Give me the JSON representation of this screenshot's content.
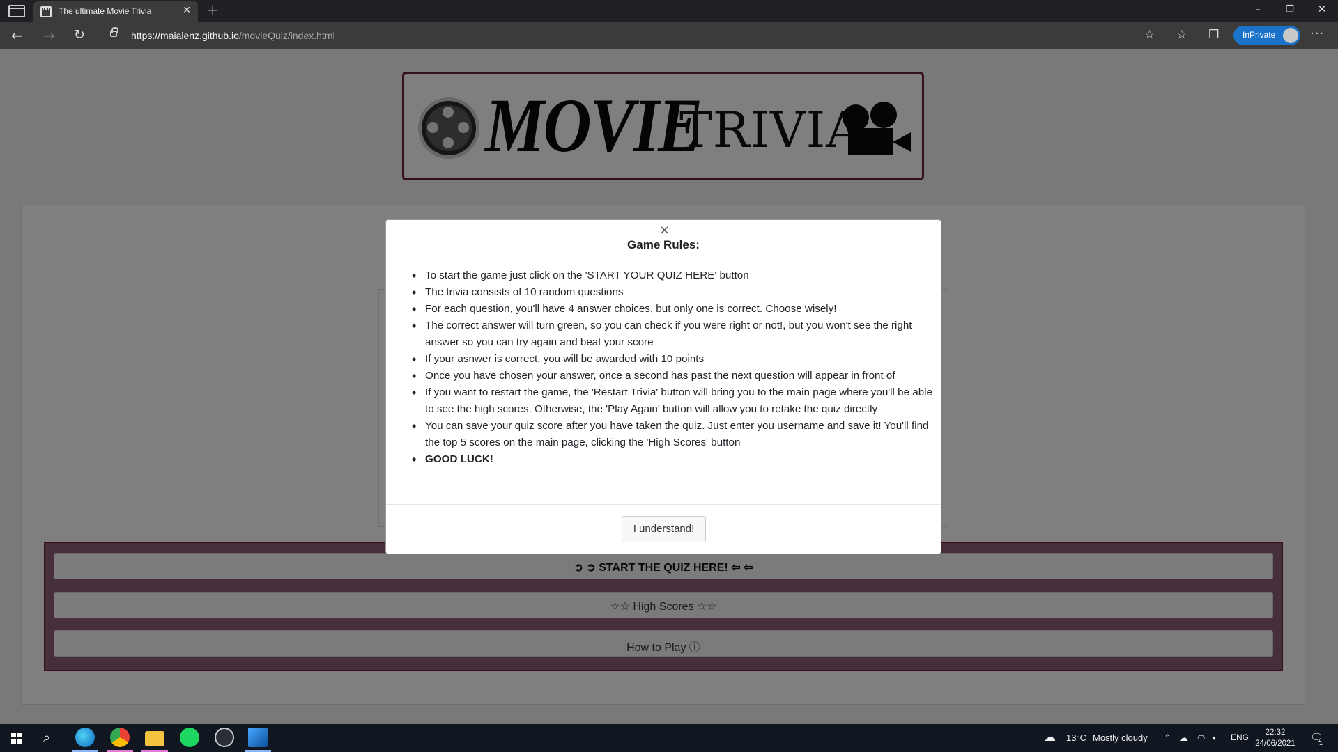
{
  "browser": {
    "tab_title": "The ultimate Movie Trivia",
    "url_host": "https://maialenz.github.io",
    "url_path": "/movieQuiz/index.html",
    "inprivate_label": "InPrivate"
  },
  "logo": {
    "word1": "MOVIE",
    "word2": "TRIVIA"
  },
  "modal": {
    "close_glyph": "×",
    "title": "Game Rules:",
    "rules": [
      "To start the game just click on the 'START YOUR QUIZ HERE' button",
      "The trivia consists of 10 random questions",
      "For each question, you'll have 4 answer choices, but only one is correct. Choose wisely!",
      "The correct answer will turn green, so you can check if you were right or not!, but you won't see the right answer so you can try again and beat your score",
      "If your asnwer is correct, you will be awarded with 10 points",
      "Once you have chosen your answer, once a second has past the next question will appear in front of",
      "If you want to restart the game, the 'Restart Trivia' button will bring you to the main page where you'll be able to see the high scores. Otherwise, the 'Play Again' button will allow you to retake the quiz directly",
      "You can save your quiz score after you have taken the quiz. Just enter you username and save it! You'll find the top 5 scores on the main page, clicking the 'High Scores' button",
      "GOOD LUCK!"
    ],
    "confirm_label": "I understand!"
  },
  "buttons": {
    "start": "➔ ➔ START THE QUIZ HERE! ← ←",
    "start_text": "START THE QUIZ HERE!",
    "high_scores": "High Scores",
    "how_to_play": "How to Play"
  },
  "taskbar": {
    "weather_temp": "13°C",
    "weather_desc": "Mostly cloudy",
    "language": "ENG",
    "time": "22:32",
    "date": "24/06/2021",
    "notification_count": "1"
  },
  "colors": {
    "accent_maroon": "#6b1f3d",
    "panel": "#8e5c76",
    "inprivate_blue": "#1a73c9"
  }
}
